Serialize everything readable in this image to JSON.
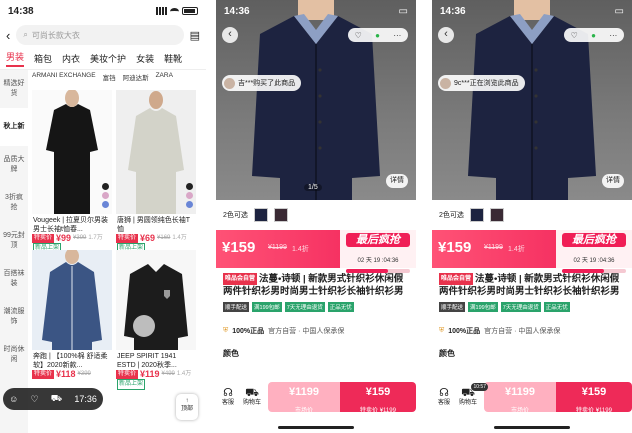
{
  "list": {
    "time": "14:38",
    "search_placeholder": "可尚长款大衣",
    "categories": [
      "男装",
      "箱包",
      "内衣",
      "美妆个护",
      "女装",
      "鞋靴"
    ],
    "brands": [
      "ARMANI EXCHANGE",
      "富铛",
      "阿迪达斯",
      "ZARA"
    ],
    "side": [
      "精选好货",
      "秋上新",
      "品质大牌",
      "3折疯抢",
      "99元封顶",
      "百搭袜装",
      "潮流服饰",
      "时尚休闲"
    ],
    "products": [
      {
        "title": "Vougeek | 拉夏贝尔男装男士长袖t恤春...",
        "tag": "特卖价",
        "price": "¥99",
        "old": "¥399",
        "sold": "1.7万",
        "new": "新品上架"
      },
      {
        "title": "唐狮 | 男圆领纯色长袖T恤",
        "tag": "特卖价",
        "price": "¥69",
        "old": "¥169",
        "sold": "1.4万",
        "new": "新品上架"
      },
      {
        "title": "奔跑 | 【100%棉 舒适柔软】2020新款...",
        "tag": "特卖价",
        "price": "¥118",
        "old": "¥399",
        "sold": "",
        "new": ""
      },
      {
        "title": "JEEP SPIRIT 1941 ESTD | 2020秋季...",
        "tag": "特卖价",
        "price": "¥119",
        "old": "¥499",
        "sold": "1.4万",
        "new": "新品上架"
      }
    ],
    "float_time": "17:36",
    "totop": "顶部"
  },
  "detail": {
    "time": "14:36",
    "bubble_a": "吉***购买了此商品",
    "bubble_b": "9c***正在浏览此商品",
    "pager": "1/5",
    "detail_btn": "详情",
    "colors_label": "2色可选",
    "price": "¥159",
    "old_price": "¥1199",
    "discount": "1.4折",
    "flash_title": "最后疯抢",
    "flash_time": "02 天 19 :04:36",
    "flash_pct": "已抢66%",
    "brand_tag": "唯品会自营",
    "title": "法蔓•诗顿 | 新款男式针织衫休闲假两件针织衫男时尚男士针织衫长袖针织衫男",
    "chips": [
      "顺手配送",
      "满199包邮",
      "7天无理由退货",
      "正品无忧"
    ],
    "auth_main": "100%正品",
    "auth_rest": "官方自营 · 中国人保承保",
    "section": "颜色",
    "service": "客服",
    "cart": "购物车",
    "cart_count": "10:57",
    "btn_market_price": "¥1199",
    "btn_market_label": "市场价",
    "btn_sale_price": "¥159",
    "btn_sale_label": "特卖价 ¥1199"
  }
}
